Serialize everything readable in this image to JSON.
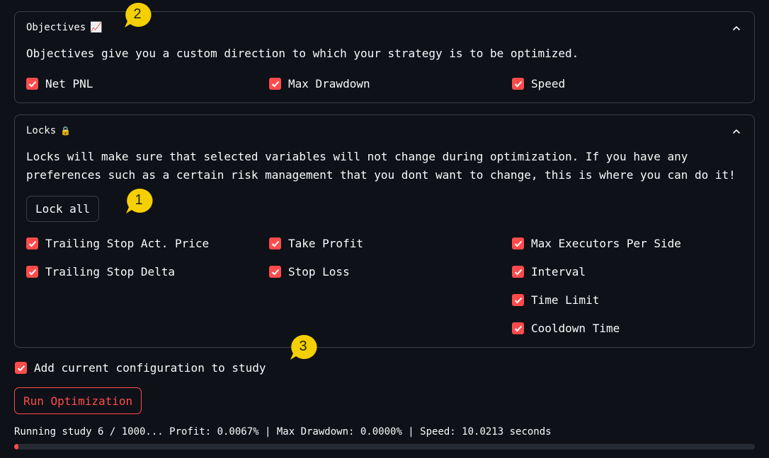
{
  "objectives": {
    "title": "Objectives",
    "title_icon": "📈",
    "description": "Objectives give you a custom direction to which your strategy is to be optimized.",
    "items": [
      {
        "label": "Net PNL",
        "checked": true
      },
      {
        "label": "Max Drawdown",
        "checked": true
      },
      {
        "label": "Speed",
        "checked": true
      }
    ]
  },
  "locks": {
    "title": "Locks",
    "title_icon": "🔒",
    "description_line1": "Locks will make sure that selected variables will not change during optimization. If you have any",
    "description_line2": "preferences such as a certain risk management that you dont want to change, this is where you can do it!",
    "lock_all_label": "Lock all",
    "items": [
      {
        "label": "Trailing Stop Act. Price",
        "checked": true
      },
      {
        "label": "Trailing Stop Delta",
        "checked": true
      },
      {
        "label": "Take Profit",
        "checked": true
      },
      {
        "label": "Stop Loss",
        "checked": true
      },
      {
        "label": "Max Executors Per Side",
        "checked": true
      },
      {
        "label": "Interval",
        "checked": true
      },
      {
        "label": "Time Limit",
        "checked": true
      },
      {
        "label": "Cooldown Time",
        "checked": true
      }
    ]
  },
  "add_config": {
    "label": "Add current configuration to study",
    "checked": true
  },
  "run_button_label": "Run Optimization",
  "status_text": "Running study 6 / 1000... Profit: 0.0067% | Max Drawdown: 0.0000% | Speed: 10.0213 seconds",
  "progress_fraction": 0.006,
  "annotations": [
    "1",
    "2",
    "3"
  ],
  "colors": {
    "accent": "#ff4b4b",
    "background": "#0e1117",
    "border": "#3b3f47",
    "bubble": "#f5d000"
  }
}
